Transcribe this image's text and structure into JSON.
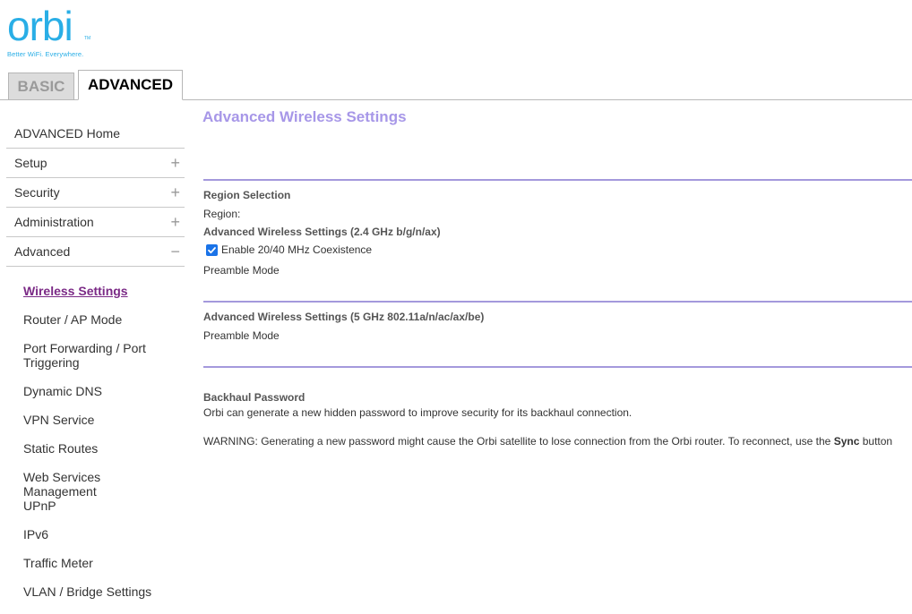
{
  "logo": {
    "word": "orbi",
    "trademark": "TM",
    "tagline": "Better WiFi. Everywhere."
  },
  "tabs": {
    "basic": "BASIC",
    "advanced": "ADVANCED"
  },
  "sidebar": {
    "items": [
      {
        "label": "ADVANCED Home",
        "expander": ""
      },
      {
        "label": "Setup",
        "expander": "+"
      },
      {
        "label": "Security",
        "expander": "+"
      },
      {
        "label": "Administration",
        "expander": "+"
      },
      {
        "label": "Advanced",
        "expander": "−"
      }
    ],
    "submenu": [
      "Wireless Settings",
      "Router / AP Mode",
      "Port Forwarding / Port Triggering",
      "Dynamic DNS",
      "VPN Service",
      "Static Routes",
      "Web Services Management",
      "UPnP",
      "IPv6",
      "Traffic Meter",
      "VLAN / Bridge Settings"
    ]
  },
  "main": {
    "title": "Advanced Wireless Settings",
    "region_heading": "Region Selection",
    "region_label": "Region:",
    "band24_heading": "Advanced Wireless Settings (2.4 GHz b/g/n/ax)",
    "coexistence_label": "Enable 20/40 MHz Coexistence",
    "coexistence_checked": true,
    "preamble_24": "Preamble Mode",
    "band5_heading": "Advanced Wireless Settings (5 GHz 802.11a/n/ac/ax/be)",
    "preamble_5": "Preamble Mode",
    "backhaul_heading": "Backhaul Password",
    "backhaul_desc": "Orbi can generate a new hidden password to improve security for its backhaul connection.",
    "warning_text": "WARNING: Generating a new password might cause the Orbi satellite to lose connection from the Orbi router. To reconnect, use the",
    "warning_bold": "Sync",
    "warning_end": "button"
  },
  "colors": {
    "brand": "#29aee6",
    "title": "#a797e8",
    "divider": "#a499dc",
    "active_link": "#7b2a86",
    "checkbox": "#1a73e8"
  }
}
